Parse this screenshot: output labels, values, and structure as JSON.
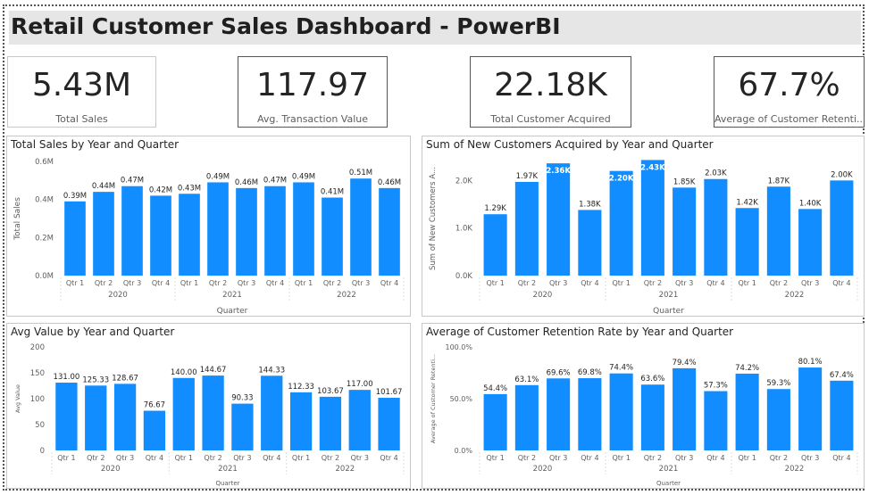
{
  "title": "Retail Customer Sales Dashboard - PowerBI",
  "colors": {
    "bar": "#118DFF",
    "title_bg": "#e6e6e6"
  },
  "kpis": [
    {
      "value": "5.43M",
      "label": "Total Sales"
    },
    {
      "value": "117.97",
      "label": "Avg. Transaction Value"
    },
    {
      "value": "22.18K",
      "label": "Total Customer Acquired"
    },
    {
      "value": "67.7%",
      "label": "Average of Customer Retenti..."
    }
  ],
  "chart_data": [
    {
      "type": "bar",
      "title": "Total Sales by Year and Quarter",
      "xlabel": "Quarter",
      "ylabel": "Total Sales",
      "ylim": [
        0,
        0.6
      ],
      "yticks": [
        "0.0M",
        "0.2M",
        "0.4M",
        "0.6M"
      ],
      "categories": [
        "Qtr 1",
        "Qtr 2",
        "Qtr 3",
        "Qtr 4",
        "Qtr 1",
        "Qtr 2",
        "Qtr 3",
        "Qtr 4",
        "Qtr 1",
        "Qtr 2",
        "Qtr 3",
        "Qtr 4"
      ],
      "years": [
        "2020",
        "2021",
        "2022"
      ],
      "values": [
        0.39,
        0.44,
        0.47,
        0.42,
        0.43,
        0.49,
        0.46,
        0.47,
        0.49,
        0.41,
        0.51,
        0.46
      ],
      "labels": [
        "0.39M",
        "0.44M",
        "0.47M",
        "0.42M",
        "0.43M",
        "0.49M",
        "0.46M",
        "0.47M",
        "0.49M",
        "0.41M",
        "0.51M",
        "0.46M"
      ]
    },
    {
      "type": "bar",
      "title": "Sum of New Customers Acquired by Year and Quarter",
      "xlabel": "Quarter",
      "ylabel": "Sum of New Customers A...",
      "ylim": [
        0,
        2400
      ],
      "yticks": [
        "0.0K",
        "1.0K",
        "2.0K"
      ],
      "categories": [
        "Qtr 1",
        "Qtr 2",
        "Qtr 3",
        "Qtr 4",
        "Qtr 1",
        "Qtr 2",
        "Qtr 3",
        "Qtr 4",
        "Qtr 1",
        "Qtr 2",
        "Qtr 3",
        "Qtr 4"
      ],
      "years": [
        "2020",
        "2021",
        "2022"
      ],
      "values": [
        1290,
        1970,
        2360,
        1380,
        2200,
        2430,
        1850,
        2030,
        1420,
        1870,
        1400,
        2000
      ],
      "labels": [
        "1.29K",
        "1.97K",
        "2.36K",
        "1.38K",
        "2.20K",
        "2.43K",
        "1.85K",
        "2.03K",
        "1.42K",
        "1.87K",
        "1.40K",
        "2.00K"
      ]
    },
    {
      "type": "bar",
      "title": "Avg Value by Year and Quarter",
      "xlabel": "Quarter",
      "ylabel": "Avg Value",
      "ylim": [
        0,
        200
      ],
      "yticks": [
        "0",
        "50",
        "100",
        "150",
        "200"
      ],
      "categories": [
        "Qtr 1",
        "Qtr 2",
        "Qtr 3",
        "Qtr 4",
        "Qtr 1",
        "Qtr 2",
        "Qtr 3",
        "Qtr 4",
        "Qtr 1",
        "Qtr 2",
        "Qtr 3",
        "Qtr 4"
      ],
      "years": [
        "2020",
        "2021",
        "2022"
      ],
      "values": [
        131.0,
        125.33,
        128.67,
        76.67,
        140.0,
        144.67,
        90.33,
        144.33,
        112.33,
        103.67,
        117.0,
        101.67
      ],
      "labels": [
        "131.00",
        "125.33",
        "128.67",
        "76.67",
        "140.00",
        "144.67",
        "90.33",
        "144.33",
        "112.33",
        "103.67",
        "117.00",
        "101.67"
      ]
    },
    {
      "type": "bar",
      "title": "Average of Customer Retention Rate by Year and Quarter",
      "xlabel": "Quarter",
      "ylabel": "Average of Customer Retenti...",
      "ylim": [
        0,
        100
      ],
      "yticks": [
        "0.0%",
        "50.0%",
        "100.0%"
      ],
      "categories": [
        "Qtr 1",
        "Qtr 2",
        "Qtr 3",
        "Qtr 4",
        "Qtr 1",
        "Qtr 2",
        "Qtr 3",
        "Qtr 4",
        "Qtr 1",
        "Qtr 2",
        "Qtr 3",
        "Qtr 4"
      ],
      "years": [
        "2020",
        "2021",
        "2022"
      ],
      "values": [
        54.4,
        63.1,
        69.6,
        69.8,
        74.4,
        63.6,
        79.4,
        57.3,
        74.2,
        59.3,
        80.1,
        67.4
      ],
      "labels": [
        "54.4%",
        "63.1%",
        "69.6%",
        "69.8%",
        "74.4%",
        "63.6%",
        "79.4%",
        "57.3%",
        "74.2%",
        "59.3%",
        "80.1%",
        "67.4%"
      ]
    }
  ]
}
